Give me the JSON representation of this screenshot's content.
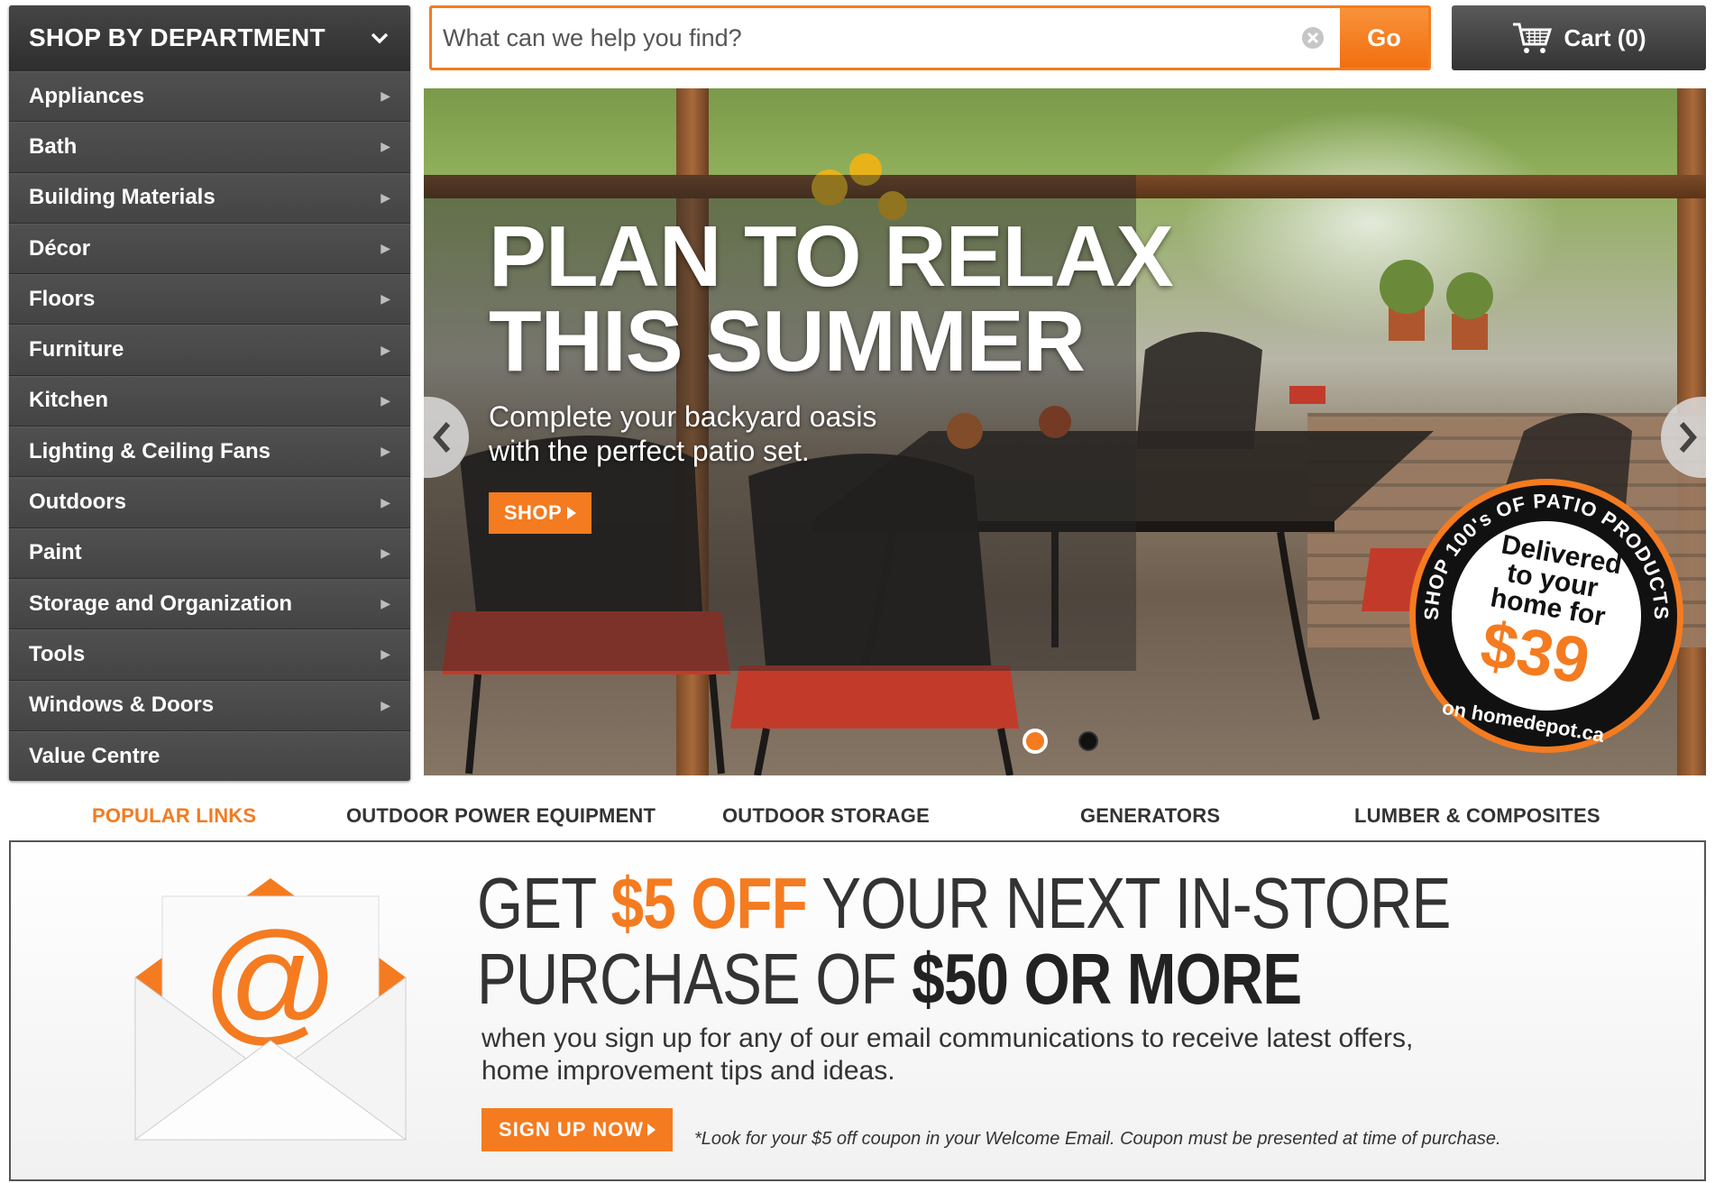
{
  "department_menu": {
    "title": "SHOP BY DEPARTMENT",
    "items": [
      {
        "label": "Appliances"
      },
      {
        "label": "Bath"
      },
      {
        "label": "Building Materials"
      },
      {
        "label": "Décor"
      },
      {
        "label": "Floors"
      },
      {
        "label": "Furniture"
      },
      {
        "label": "Kitchen"
      },
      {
        "label": "Lighting & Ceiling Fans"
      },
      {
        "label": "Outdoors"
      },
      {
        "label": "Paint"
      },
      {
        "label": "Storage and Organization"
      },
      {
        "label": "Tools"
      },
      {
        "label": "Windows & Doors"
      },
      {
        "label": "Value Centre"
      }
    ]
  },
  "search": {
    "placeholder": "What can we help you find?",
    "button_label": "Go"
  },
  "cart": {
    "label": "Cart (0)"
  },
  "hero": {
    "headline_line1": "PLAN TO RELAX",
    "headline_line2": "THIS SUMMER",
    "subtext_line1": "Complete your backyard oasis",
    "subtext_line2": "with the perfect patio set.",
    "shop_label": "SHOP",
    "badge": {
      "ring_text": "SHOP 100's OF PATIO PRODUCTS",
      "line1": "Delivered",
      "line2": "to your",
      "line3": "home for",
      "price": "$39",
      "footer": "on homedepot.ca"
    },
    "slide_count": 2,
    "active_slide": 1
  },
  "popular_links": {
    "title": "POPULAR LINKS",
    "links": [
      {
        "label": "OUTDOOR POWER EQUIPMENT"
      },
      {
        "label": "OUTDOOR STORAGE"
      },
      {
        "label": "GENERATORS"
      },
      {
        "label": "LUMBER & COMPOSITES"
      }
    ]
  },
  "promo": {
    "line1_prefix": "GET ",
    "line1_highlight": "$5 OFF",
    "line1_suffix": " YOUR NEXT IN-STORE",
    "line2_prefix": "PURCHASE OF ",
    "line2_bold": "$50 OR MORE",
    "description_line1": "when you sign up for any of our email communications to receive latest offers,",
    "description_line2": "home improvement tips and ideas.",
    "signup_label": "SIGN UP NOW",
    "fine_print": "*Look for your $5 off coupon in your Welcome Email. Coupon must be presented at time of purchase."
  },
  "colors": {
    "accent": "#f47b20",
    "menu_bg": "#4a4a4a",
    "text_dark": "#333333"
  }
}
